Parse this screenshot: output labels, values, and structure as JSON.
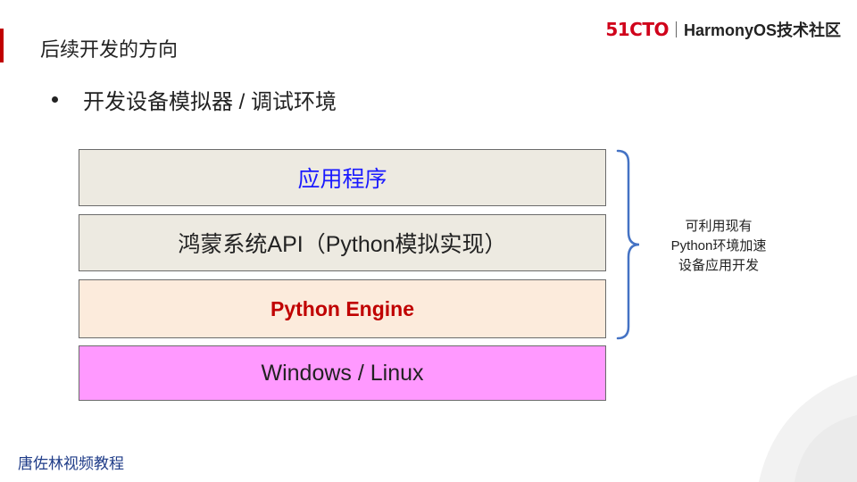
{
  "header": {
    "title": "后续开发的方向",
    "brand_logo": "51CTO",
    "brand_name": "HarmonyOS技术社区"
  },
  "bullet": {
    "text": "开发设备模拟器 / 调试环境"
  },
  "stack": {
    "layers": [
      {
        "label": "应用程序",
        "color": "#1a1aff"
      },
      {
        "label": "鸿蒙系统API（Python模拟实现）",
        "color": "#222222"
      },
      {
        "label": "Python Engine",
        "color": "#c00000"
      },
      {
        "label": "Windows / Linux",
        "color": "#222222"
      }
    ]
  },
  "note": {
    "lines": [
      "可利用现有",
      "Python环境加速",
      "设备应用开发"
    ]
  },
  "footer": {
    "text": "唐佐林视频教程"
  },
  "colors": {
    "accent": "#c00000",
    "layer_bg_light": "#edeae1",
    "layer_bg_engine": "#fcebdc",
    "layer_bg_os": "#ff99ff",
    "brace": "#4472c4"
  }
}
